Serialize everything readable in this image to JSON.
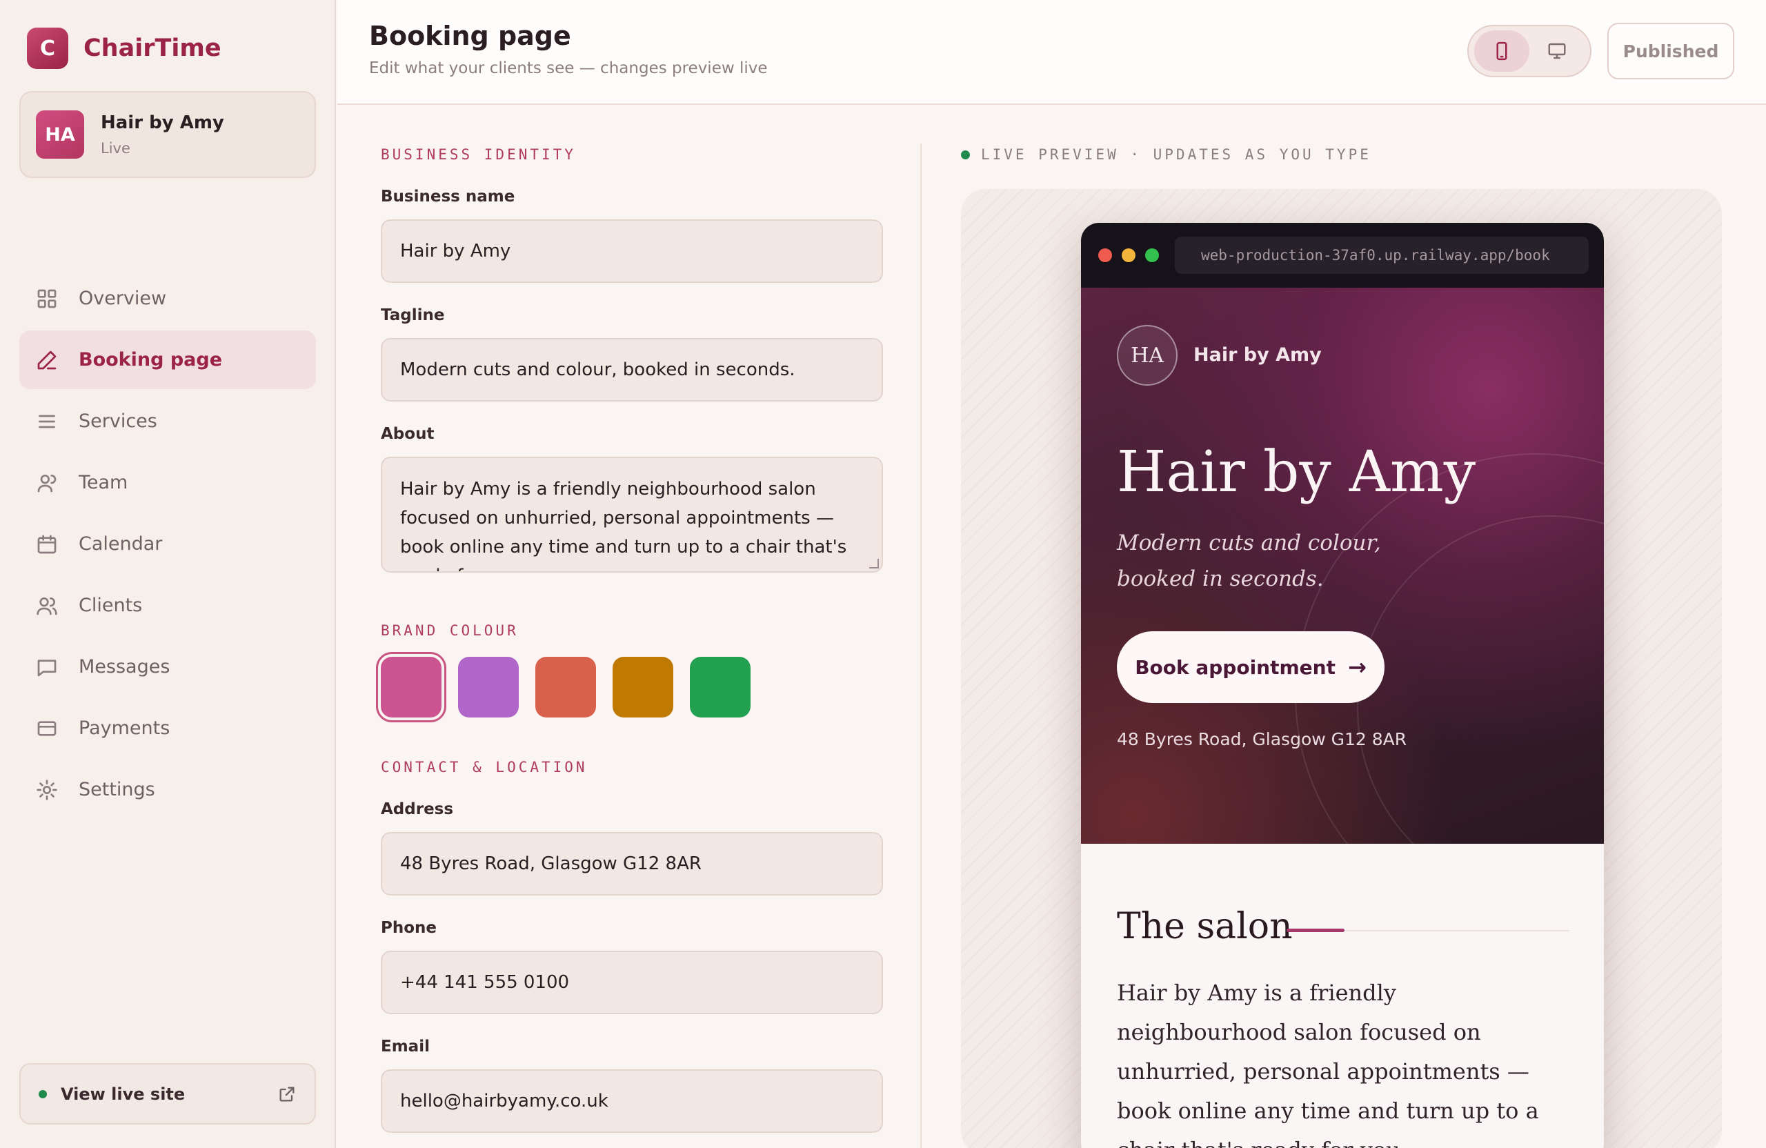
{
  "brand": {
    "logo_letter": "C",
    "name": "ChairTime"
  },
  "account": {
    "initials": "HA",
    "name": "Hair by Amy",
    "status": "Live"
  },
  "nav": {
    "items": [
      {
        "label": "Overview",
        "icon": "grid-icon"
      },
      {
        "label": "Booking page",
        "icon": "pencil-icon",
        "active": true
      },
      {
        "label": "Services",
        "icon": "list-icon"
      },
      {
        "label": "Team",
        "icon": "user-icon"
      },
      {
        "label": "Calendar",
        "icon": "calendar-icon"
      },
      {
        "label": "Clients",
        "icon": "users-icon"
      },
      {
        "label": "Messages",
        "icon": "message-icon"
      },
      {
        "label": "Payments",
        "icon": "card-icon"
      },
      {
        "label": "Settings",
        "icon": "sun-gear-icon"
      }
    ]
  },
  "view_live": {
    "label": "View live site",
    "icon": "external-link-icon"
  },
  "header": {
    "title": "Booking page",
    "subtitle": "Edit what your clients see — changes preview live",
    "device_toggle": {
      "mobile_icon": "phone-icon",
      "desktop_icon": "monitor-icon",
      "selected": "mobile"
    },
    "published_label": "Published"
  },
  "form": {
    "identity_section": "BUSINESS IDENTITY",
    "business_name_label": "Business name",
    "business_name_value": "Hair by Amy",
    "tagline_label": "Tagline",
    "tagline_value": "Modern cuts and colour, booked in seconds.",
    "about_label": "About",
    "about_value": "Hair by Amy is a friendly neighbourhood salon focused on unhurried, personal appointments — book online any time and turn up to a chair that's ready for you.",
    "brand_colour_section": "BRAND COLOUR",
    "swatches": [
      "#cc5591",
      "#b065c8",
      "#d9604a",
      "#c07a04",
      "#22a150"
    ],
    "selected_swatch": "#cc5591",
    "contact_section": "CONTACT & LOCATION",
    "address_label": "Address",
    "address_value": "48 Byres Road, Glasgow G12 8AR",
    "phone_label": "Phone",
    "phone_value": "+44 141 555 0100",
    "email_label": "Email",
    "email_value": "hello@hairbyamy.co.uk"
  },
  "preview": {
    "label": "LIVE PREVIEW · UPDATES AS YOU TYPE",
    "url": "web-production-37af0.up.railway.app/book",
    "traffic_lights": [
      "#ef5b4f",
      "#f2b43a",
      "#34c04d"
    ],
    "hero": {
      "avatar_initials": "HA",
      "business_name": "Hair by Amy",
      "title": "Hair by Amy",
      "tagline": "Modern cuts and colour, booked in seconds.",
      "cta_label": "Book appointment",
      "cta_arrow": "→",
      "address": "48 Byres Road, Glasgow G12 8AR"
    },
    "salon": {
      "heading": "The salon",
      "text": "Hair by Amy is a friendly neighbourhood salon focused on unhurried, personal appointments — book online any time and turn up to a chair that's ready for you."
    }
  },
  "colors": {
    "accent": "#9a2347",
    "live_dot": "#1f8a4c"
  }
}
